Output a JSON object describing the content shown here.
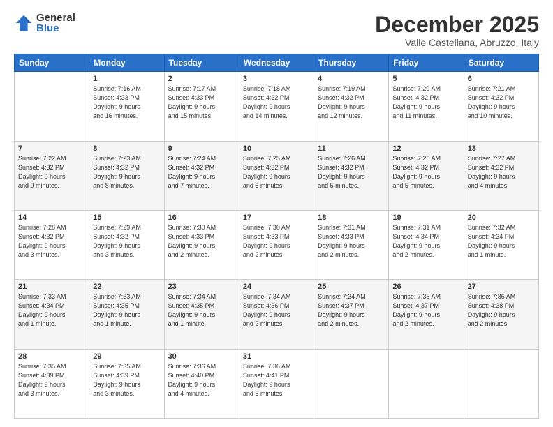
{
  "logo": {
    "general": "General",
    "blue": "Blue"
  },
  "title": "December 2025",
  "location": "Valle Castellana, Abruzzo, Italy",
  "days_header": [
    "Sunday",
    "Monday",
    "Tuesday",
    "Wednesday",
    "Thursday",
    "Friday",
    "Saturday"
  ],
  "weeks": [
    [
      {
        "day": "",
        "info": ""
      },
      {
        "day": "1",
        "info": "Sunrise: 7:16 AM\nSunset: 4:33 PM\nDaylight: 9 hours\nand 16 minutes."
      },
      {
        "day": "2",
        "info": "Sunrise: 7:17 AM\nSunset: 4:33 PM\nDaylight: 9 hours\nand 15 minutes."
      },
      {
        "day": "3",
        "info": "Sunrise: 7:18 AM\nSunset: 4:32 PM\nDaylight: 9 hours\nand 14 minutes."
      },
      {
        "day": "4",
        "info": "Sunrise: 7:19 AM\nSunset: 4:32 PM\nDaylight: 9 hours\nand 12 minutes."
      },
      {
        "day": "5",
        "info": "Sunrise: 7:20 AM\nSunset: 4:32 PM\nDaylight: 9 hours\nand 11 minutes."
      },
      {
        "day": "6",
        "info": "Sunrise: 7:21 AM\nSunset: 4:32 PM\nDaylight: 9 hours\nand 10 minutes."
      }
    ],
    [
      {
        "day": "7",
        "info": "Sunrise: 7:22 AM\nSunset: 4:32 PM\nDaylight: 9 hours\nand 9 minutes."
      },
      {
        "day": "8",
        "info": "Sunrise: 7:23 AM\nSunset: 4:32 PM\nDaylight: 9 hours\nand 8 minutes."
      },
      {
        "day": "9",
        "info": "Sunrise: 7:24 AM\nSunset: 4:32 PM\nDaylight: 9 hours\nand 7 minutes."
      },
      {
        "day": "10",
        "info": "Sunrise: 7:25 AM\nSunset: 4:32 PM\nDaylight: 9 hours\nand 6 minutes."
      },
      {
        "day": "11",
        "info": "Sunrise: 7:26 AM\nSunset: 4:32 PM\nDaylight: 9 hours\nand 5 minutes."
      },
      {
        "day": "12",
        "info": "Sunrise: 7:26 AM\nSunset: 4:32 PM\nDaylight: 9 hours\nand 5 minutes."
      },
      {
        "day": "13",
        "info": "Sunrise: 7:27 AM\nSunset: 4:32 PM\nDaylight: 9 hours\nand 4 minutes."
      }
    ],
    [
      {
        "day": "14",
        "info": "Sunrise: 7:28 AM\nSunset: 4:32 PM\nDaylight: 9 hours\nand 3 minutes."
      },
      {
        "day": "15",
        "info": "Sunrise: 7:29 AM\nSunset: 4:32 PM\nDaylight: 9 hours\nand 3 minutes."
      },
      {
        "day": "16",
        "info": "Sunrise: 7:30 AM\nSunset: 4:33 PM\nDaylight: 9 hours\nand 2 minutes."
      },
      {
        "day": "17",
        "info": "Sunrise: 7:30 AM\nSunset: 4:33 PM\nDaylight: 9 hours\nand 2 minutes."
      },
      {
        "day": "18",
        "info": "Sunrise: 7:31 AM\nSunset: 4:33 PM\nDaylight: 9 hours\nand 2 minutes."
      },
      {
        "day": "19",
        "info": "Sunrise: 7:31 AM\nSunset: 4:34 PM\nDaylight: 9 hours\nand 2 minutes."
      },
      {
        "day": "20",
        "info": "Sunrise: 7:32 AM\nSunset: 4:34 PM\nDaylight: 9 hours\nand 1 minute."
      }
    ],
    [
      {
        "day": "21",
        "info": "Sunrise: 7:33 AM\nSunset: 4:34 PM\nDaylight: 9 hours\nand 1 minute."
      },
      {
        "day": "22",
        "info": "Sunrise: 7:33 AM\nSunset: 4:35 PM\nDaylight: 9 hours\nand 1 minute."
      },
      {
        "day": "23",
        "info": "Sunrise: 7:34 AM\nSunset: 4:35 PM\nDaylight: 9 hours\nand 1 minute."
      },
      {
        "day": "24",
        "info": "Sunrise: 7:34 AM\nSunset: 4:36 PM\nDaylight: 9 hours\nand 2 minutes."
      },
      {
        "day": "25",
        "info": "Sunrise: 7:34 AM\nSunset: 4:37 PM\nDaylight: 9 hours\nand 2 minutes."
      },
      {
        "day": "26",
        "info": "Sunrise: 7:35 AM\nSunset: 4:37 PM\nDaylight: 9 hours\nand 2 minutes."
      },
      {
        "day": "27",
        "info": "Sunrise: 7:35 AM\nSunset: 4:38 PM\nDaylight: 9 hours\nand 2 minutes."
      }
    ],
    [
      {
        "day": "28",
        "info": "Sunrise: 7:35 AM\nSunset: 4:39 PM\nDaylight: 9 hours\nand 3 minutes."
      },
      {
        "day": "29",
        "info": "Sunrise: 7:35 AM\nSunset: 4:39 PM\nDaylight: 9 hours\nand 3 minutes."
      },
      {
        "day": "30",
        "info": "Sunrise: 7:36 AM\nSunset: 4:40 PM\nDaylight: 9 hours\nand 4 minutes."
      },
      {
        "day": "31",
        "info": "Sunrise: 7:36 AM\nSunset: 4:41 PM\nDaylight: 9 hours\nand 5 minutes."
      },
      {
        "day": "",
        "info": ""
      },
      {
        "day": "",
        "info": ""
      },
      {
        "day": "",
        "info": ""
      }
    ]
  ]
}
